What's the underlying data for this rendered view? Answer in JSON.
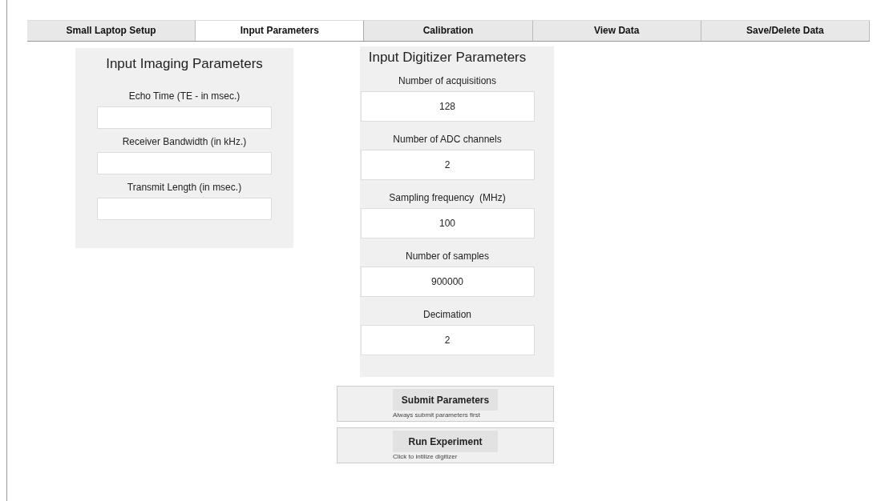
{
  "tabs": [
    {
      "label": "Small Laptop Setup",
      "selected": false
    },
    {
      "label": "Input Parameters",
      "selected": true
    },
    {
      "label": "Calibration",
      "selected": false
    },
    {
      "label": "View Data",
      "selected": false
    },
    {
      "label": "Save/Delete Data",
      "selected": false
    }
  ],
  "imaging_panel": {
    "title": "Input Imaging Parameters",
    "fields": [
      {
        "label": "Echo Time (TE - in msec.)"
      },
      {
        "label": "Receiver Bandwidth (in kHz.)"
      },
      {
        "label": "Transmit Length (in msec.)"
      }
    ]
  },
  "digitizer_panel": {
    "title": "Input Digitizer Parameters",
    "fields": [
      {
        "label": "Number of acquisitions",
        "value": "128"
      },
      {
        "label": "Number of ADC channels",
        "value": "2"
      },
      {
        "label": "Sampling frequency  (MHz)",
        "value": "100"
      },
      {
        "label": "Number of samples",
        "value": "900000"
      },
      {
        "label": "Decimation",
        "value": "2"
      }
    ]
  },
  "actions": [
    {
      "button": "Submit Parameters",
      "note": "Always submit parameters first"
    },
    {
      "button": "Run Experiment",
      "note": "Click to intilize digitizer"
    }
  ]
}
